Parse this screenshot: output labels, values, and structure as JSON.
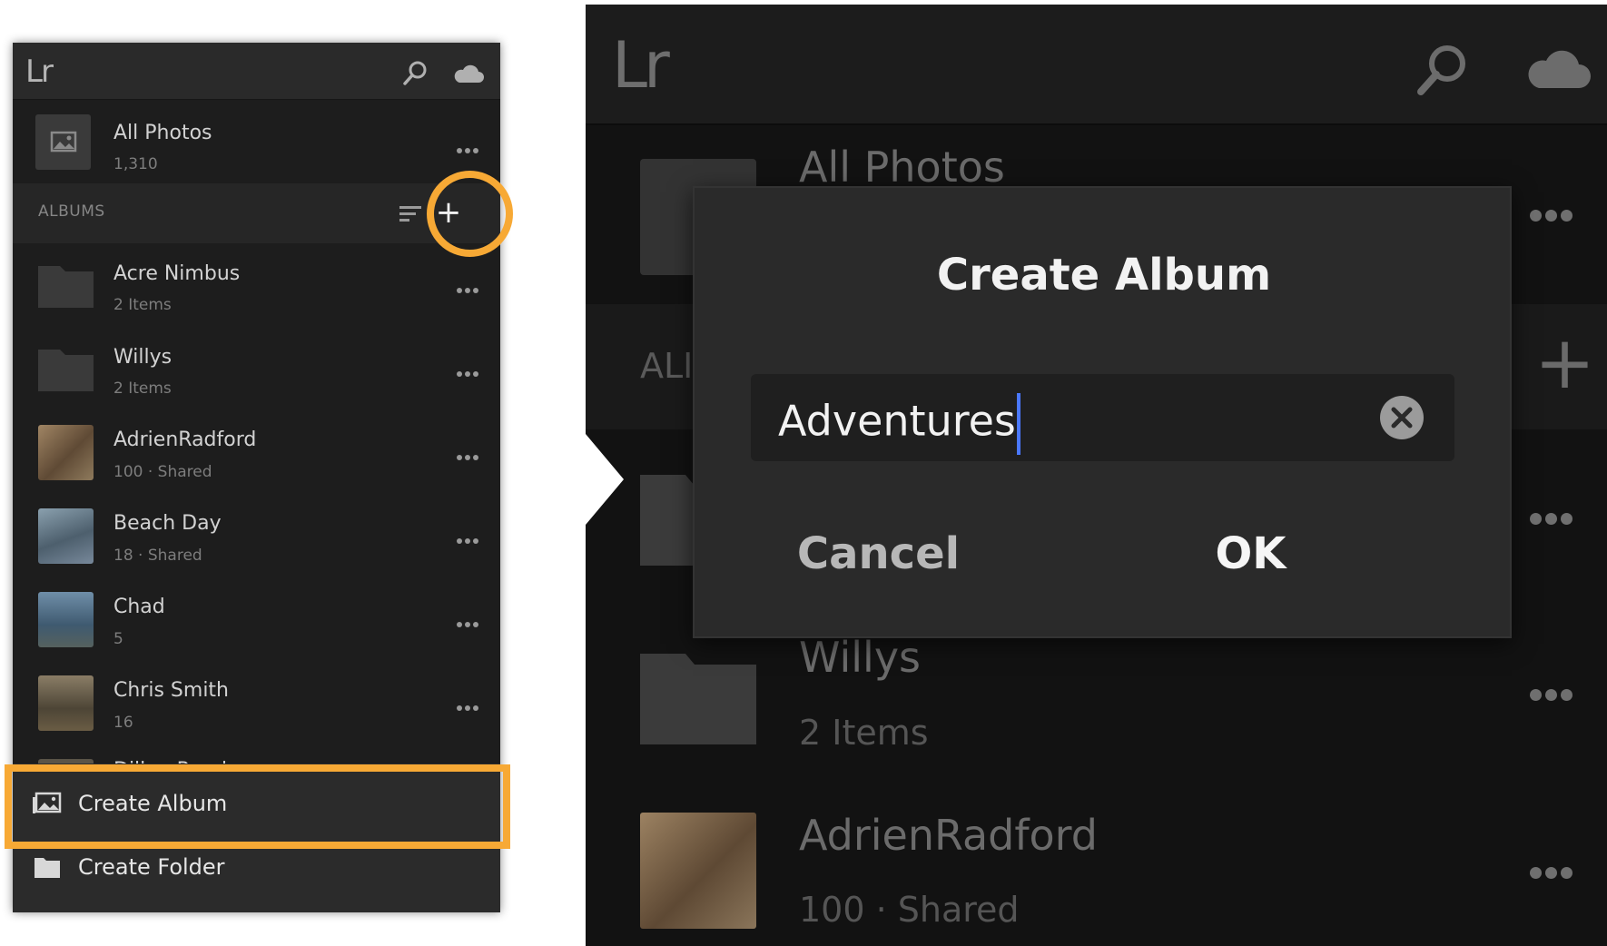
{
  "app": {
    "logo": "Lr"
  },
  "left": {
    "all_photos": {
      "title": "All Photos",
      "count": "1,310"
    },
    "albums_label": "ALBUMS",
    "add_label": "+",
    "albums": [
      {
        "title": "Acre Nimbus",
        "sub": "2 Items",
        "thumb": "folder"
      },
      {
        "title": "Willys",
        "sub": "2 Items",
        "thumb": "folder"
      },
      {
        "title": "AdrienRadford",
        "sub": "100 · Shared",
        "thumb": "photo",
        "color": "#7d6548"
      },
      {
        "title": "Beach Day",
        "sub": "18 · Shared",
        "thumb": "photo",
        "color": "#5f7585"
      },
      {
        "title": "Chad",
        "sub": "5",
        "thumb": "photo",
        "color": "#44647c"
      },
      {
        "title": "Chris Smith",
        "sub": "16",
        "thumb": "photo",
        "color": "#5c5140"
      }
    ],
    "partial_album": "Dillon Reed",
    "sheet": {
      "create_album": "Create Album",
      "create_folder": "Create Folder"
    },
    "highlight_color": "#f7a935"
  },
  "right": {
    "all_photos": "All Photos",
    "albums_label": "ALI",
    "add_label": "+",
    "willys": {
      "title": "Willys",
      "sub": "2 Items"
    },
    "adrien": {
      "title": "AdrienRadford",
      "sub": "100 · Shared"
    },
    "dialog": {
      "title": "Create Album",
      "input_value": "Adventures",
      "cancel": "Cancel",
      "ok": "OK"
    }
  },
  "icons": [
    "search-icon",
    "cloud-icon",
    "sort-icon",
    "plus-icon",
    "photo-icon",
    "folder-icon",
    "more-icon",
    "clear-icon"
  ]
}
